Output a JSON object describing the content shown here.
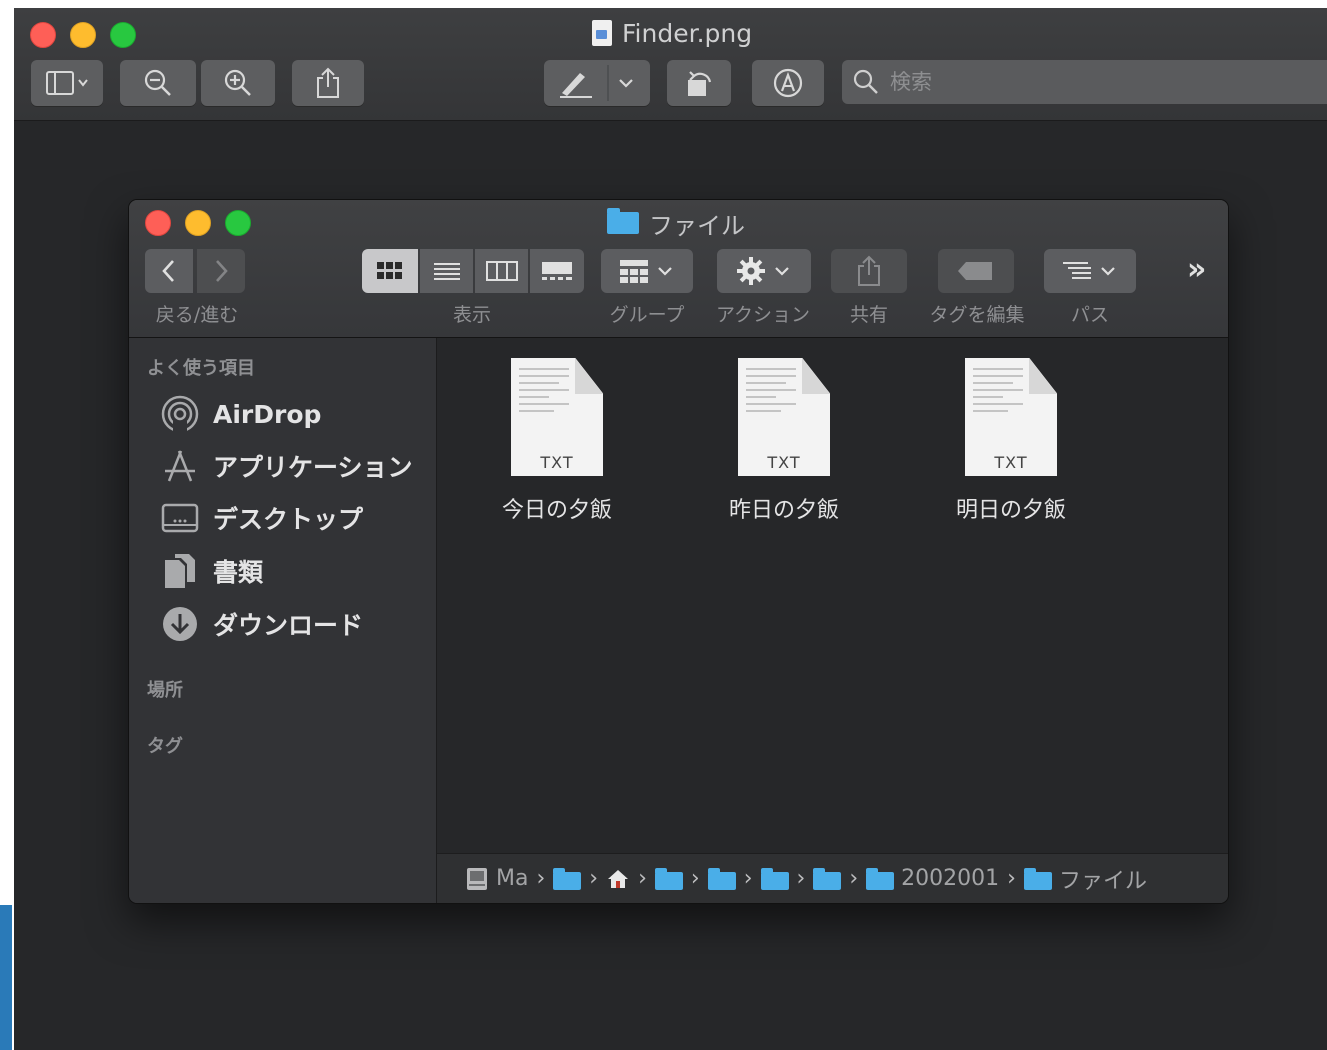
{
  "preview_window": {
    "title": "Finder.png",
    "toolbar": {
      "sidebar_icon": "sidebar-toggle-icon",
      "zoom_out_icon": "zoom-out-icon",
      "zoom_in_icon": "zoom-in-icon",
      "share_icon": "share-icon",
      "markup_icon": "pen-icon",
      "rotate_icon": "rotate-icon",
      "annotate_icon": "markup-circle-icon",
      "search_placeholder": "検索"
    }
  },
  "finder_window": {
    "title": "ファイル",
    "toolbar": {
      "back_forward_label": "戻る/進む",
      "view_label": "表示",
      "group_label": "グループ",
      "action_label": "アクション",
      "share_label": "共有",
      "tags_label": "タグを編集",
      "path_label": "パス",
      "overflow": "»"
    },
    "sidebar": {
      "favorites_heading": "よく使う項目",
      "items": [
        {
          "label": "AirDrop",
          "icon": "airdrop-icon"
        },
        {
          "label": "アプリケーション",
          "icon": "applications-icon"
        },
        {
          "label": "デスクトップ",
          "icon": "desktop-icon"
        },
        {
          "label": "書類",
          "icon": "documents-icon"
        },
        {
          "label": "ダウンロード",
          "icon": "downloads-icon"
        }
      ],
      "locations_heading": "場所",
      "tags_heading": "タグ"
    },
    "files": [
      {
        "name": "今日の夕飯",
        "ext": "TXT"
      },
      {
        "name": "昨日の夕飯",
        "ext": "TXT"
      },
      {
        "name": "明日の夕飯",
        "ext": "TXT"
      }
    ],
    "path_bar": {
      "root": "Ma",
      "folder_2002": "2002001",
      "current": "ファイル"
    }
  },
  "colors": {
    "close": "#fe5f57",
    "minimize": "#febc2e",
    "zoom": "#28c840",
    "folder_blue": "#4aaee8"
  }
}
